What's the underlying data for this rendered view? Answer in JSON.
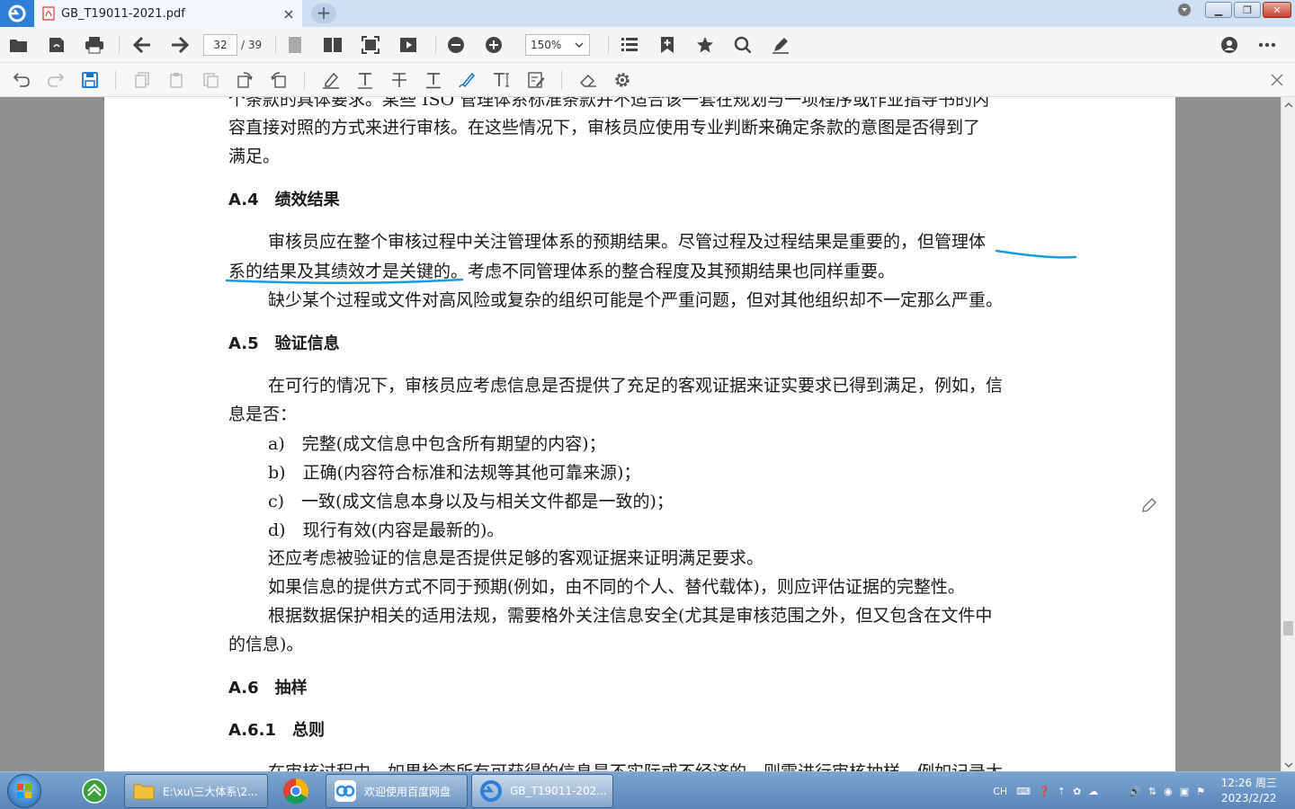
{
  "window": {
    "tab_title": "GB_T19011-2021.pdf"
  },
  "toolbar": {
    "current_page": "32",
    "total_pages": "/ 39",
    "zoom": "150%"
  },
  "document": {
    "partial_line_top": "个条款的具体要求。某些 ISO 管理体系标准条款并不适合该一套在规划与一项程序或作业指导书的内",
    "lines": [
      "容直接对照的方式来进行审核。在这些情况下，审核员应使用专业判断来确定条款的意图是否得到了",
      "满足。"
    ],
    "a4_heading": "A.4　绩效结果",
    "a4_p1_line1": "审核员应在整个审核过程中关注管理体系的预期结果。尽管过程及过程结果是重要的，但管理体",
    "a4_p1_line2": "系的结果及其绩效才是关键的。考虑不同管理体系的整合程度及其预期结果也同样重要。",
    "a4_p2": "缺少某个过程或文件对高风险或复杂的组织可能是个严重问题，但对其他组织却不一定那么严重。",
    "a5_heading": "A.5　验证信息",
    "a5_p1_line1": "在可行的情况下，审核员应考虑信息是否提供了充足的客观证据来证实要求已得到满足，例如，信",
    "a5_p1_line2": "息是否：",
    "a5_items": [
      "a)　完整(成文信息中包含所有期望的内容)；",
      "b)　正确(内容符合标准和法规等其他可靠来源)；",
      "c)　一致(成文信息本身以及与相关文件都是一致的)；",
      "d)　现行有效(内容是最新的)。"
    ],
    "a5_p2": "还应考虑被验证的信息是否提供足够的客观证据来证明满足要求。",
    "a5_p3": "如果信息的提供方式不同于预期(例如，由不同的个人、替代载体)，则应评估证据的完整性。",
    "a5_p4_line1": "根据数据保护相关的适用法规，需要格外关注信息安全(尤其是审核范围之外，但又包含在文件中",
    "a5_p4_line2": "的信息)。",
    "a6_heading": "A.6　抽样",
    "a61_heading": "A.6.1　总则",
    "partial_line_bottom": "在审核过程中，如果检查所有可获得的信息是不实际或不经济的，则需进行审核抽样，例如记录太"
  },
  "taskbar": {
    "explorer_label": "E:\\xu\\三大体系\\2...",
    "baidu_label": "欢迎使用百度网盘",
    "pdf_label": "GB_T19011-202...",
    "lang": "CH",
    "time": "12:26 周三",
    "date": "2023/2/22"
  },
  "colors": {
    "annotation": "#1a9be0",
    "app_blue": "#2f7fd6"
  }
}
